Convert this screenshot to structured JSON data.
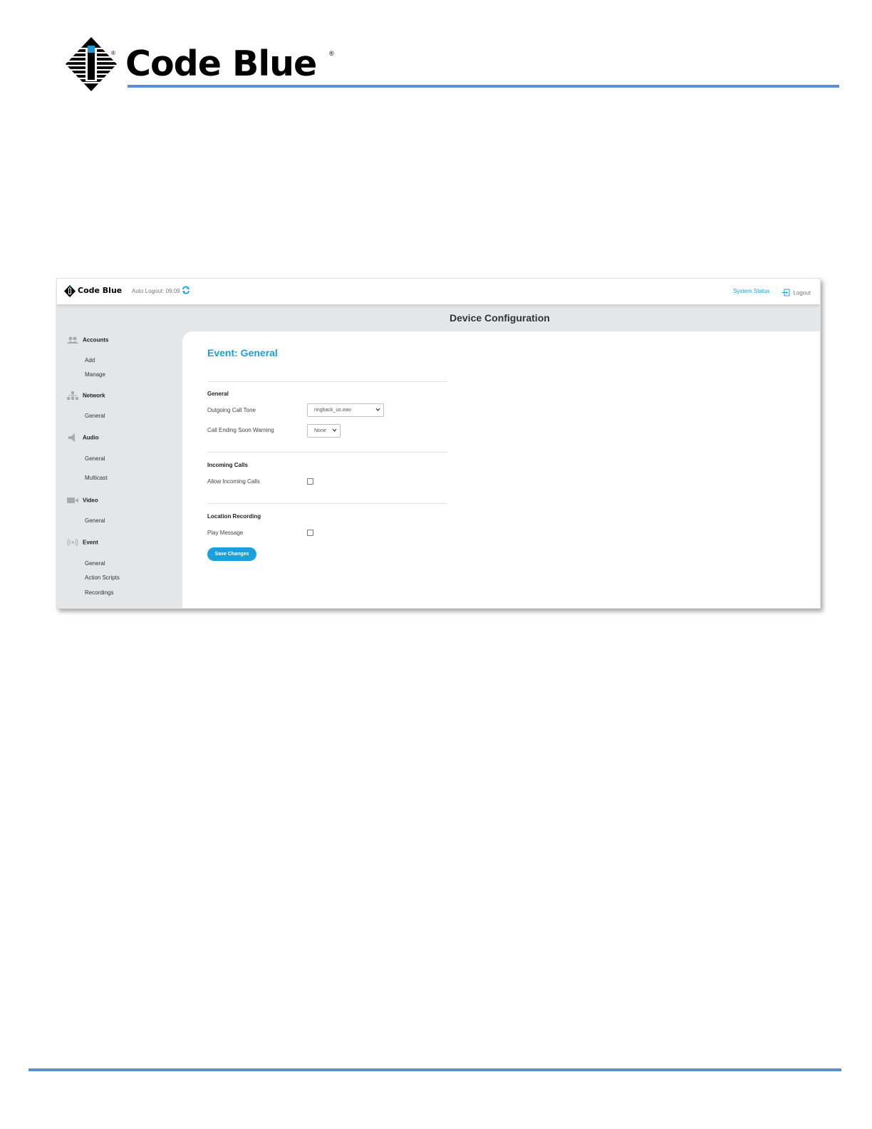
{
  "document": {
    "brand": {
      "name": "Code Blue",
      "registered_mark": "®"
    }
  },
  "app": {
    "brand_name": "Code Blue",
    "auto_logout": "Auto Logout: 09:09",
    "system_status": "System Status",
    "logout": "Logout",
    "page_title": "Device Configuration"
  },
  "sidebar": {
    "sections": [
      {
        "label": "Accounts",
        "icon": "users-icon",
        "items": [
          "Add",
          "Manage"
        ]
      },
      {
        "label": "Network",
        "icon": "network-icon",
        "items": [
          "General"
        ]
      },
      {
        "label": "Audio",
        "icon": "speaker-icon",
        "items": [
          "General",
          "Multicast"
        ]
      },
      {
        "label": "Video",
        "icon": "video-camera-icon",
        "items": [
          "General"
        ]
      },
      {
        "label": "Event",
        "icon": "broadcast-icon",
        "items": [
          "General",
          "Action Scripts",
          "Recordings"
        ]
      }
    ]
  },
  "main": {
    "title": "Event: General",
    "general": {
      "heading": "General",
      "outgoing_call_tone_label": "Outgoing Call Tone",
      "outgoing_call_tone_value": "ringback_us.wav",
      "call_ending_label": "Call Ending Soon Warning",
      "call_ending_value": "None"
    },
    "incoming": {
      "heading": "Incoming Calls",
      "allow_label": "Allow Incoming Calls",
      "allow_checked": false
    },
    "location": {
      "heading": "Location Recording",
      "play_label": "Play Message",
      "play_checked": false
    },
    "save_label": "Save Changes"
  },
  "colors": {
    "accent": "#1aa0dc",
    "rule": "#5b8fd0",
    "sidebar_bg": "#e4e6e8"
  }
}
